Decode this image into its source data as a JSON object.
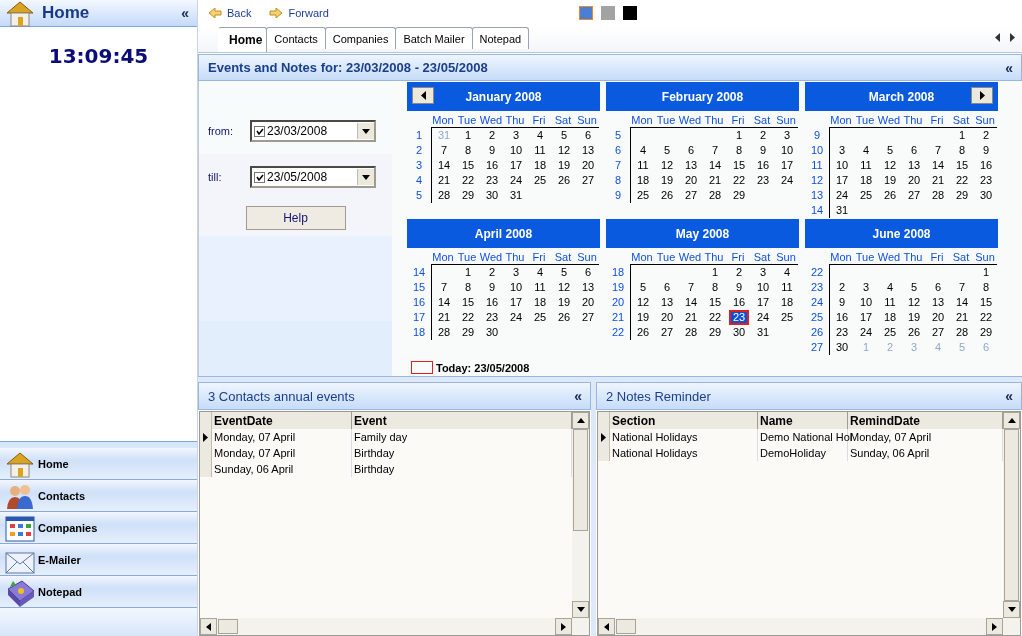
{
  "sidebar": {
    "title": "Home",
    "collapse": "«",
    "clock": "13:09:45",
    "nav": [
      {
        "label": "Home",
        "kind": "home"
      },
      {
        "label": "Contacts",
        "kind": "contacts"
      },
      {
        "label": "Companies",
        "kind": "companies"
      },
      {
        "label": "E-Mailer",
        "kind": "mailer"
      },
      {
        "label": "Notepad",
        "kind": "notepad"
      }
    ]
  },
  "toolbar": {
    "back": "Back",
    "forward": "Forward",
    "swatches": [
      {
        "color": "#4a7fd6",
        "selected": true
      },
      {
        "color": "#a3a3a3",
        "selected": false
      },
      {
        "color": "#000000",
        "selected": false
      }
    ]
  },
  "tabs": [
    {
      "label": "Home",
      "selected": true
    },
    {
      "label": "Contacts",
      "selected": false
    },
    {
      "label": "Companies",
      "selected": false
    },
    {
      "label": "Batch Mailer",
      "selected": false
    },
    {
      "label": "Notepad",
      "selected": false
    }
  ],
  "events_panel": {
    "title": "Events and Notes for: 23/03/2008 - 23/05/2008",
    "collapse": "«",
    "from": {
      "label": "from:",
      "checked": true,
      "value": "23/03/2008"
    },
    "till": {
      "label": "till:",
      "checked": true,
      "value": "23/05/2008"
    },
    "help_button": "Help",
    "months": [
      {
        "title": "January 2008",
        "prev_button": true,
        "weekdays": [
          "Mon",
          "Tue",
          "Wed",
          "Thu",
          "Fri",
          "Sat",
          "Sun"
        ],
        "weeks": [
          {
            "number": "1",
            "days": [
              {
                "day": "31",
                "dimmed": true
              },
              "1",
              "2",
              "3",
              "4",
              "5",
              "6"
            ]
          },
          {
            "number": "2",
            "days": [
              "7",
              "8",
              "9",
              "10",
              "11",
              "12",
              "13"
            ]
          },
          {
            "number": "3",
            "days": [
              "14",
              "15",
              "16",
              "17",
              "18",
              "19",
              "20"
            ]
          },
          {
            "number": "4",
            "days": [
              "21",
              "22",
              "23",
              "24",
              "25",
              "26",
              "27"
            ]
          },
          {
            "number": "5",
            "days": [
              "28",
              "29",
              "30",
              "31"
            ]
          }
        ]
      },
      {
        "title": "February 2008",
        "weekdays": [
          "Mon",
          "Tue",
          "Wed",
          "Thu",
          "Fri",
          "Sat",
          "Sun"
        ],
        "weeks": [
          {
            "number": "5",
            "right_aligned": true,
            "days": [
              "1",
              "2",
              "3"
            ]
          },
          {
            "number": "6",
            "days": [
              "4",
              "5",
              "6",
              "7",
              "8",
              "9",
              "10"
            ]
          },
          {
            "number": "7",
            "days": [
              "11",
              "12",
              "13",
              "14",
              "15",
              "16",
              "17"
            ]
          },
          {
            "number": "8",
            "days": [
              "18",
              "19",
              "20",
              "21",
              "22",
              "23",
              "24"
            ]
          },
          {
            "number": "9",
            "days": [
              "25",
              "26",
              "27",
              "28",
              "29"
            ]
          }
        ]
      },
      {
        "title": "March 2008",
        "next_button": true,
        "weekdays": [
          "Mon",
          "Tue",
          "Wed",
          "Thu",
          "Fri",
          "Sat",
          "Sun"
        ],
        "weeks": [
          {
            "number": "9",
            "right_aligned": true,
            "days": [
              "1",
              "2"
            ]
          },
          {
            "number": "10",
            "days": [
              "3",
              "4",
              "5",
              "6",
              "7",
              "8",
              "9"
            ]
          },
          {
            "number": "11",
            "days": [
              "10",
              "11",
              "12",
              "13",
              "14",
              "15",
              "16"
            ]
          },
          {
            "number": "12",
            "days": [
              "17",
              "18",
              "19",
              "20",
              "21",
              "22",
              "23"
            ]
          },
          {
            "number": "13",
            "days": [
              "24",
              "25",
              "26",
              "27",
              "28",
              "29",
              "30"
            ]
          },
          {
            "number": "14",
            "days": [
              "31"
            ]
          }
        ]
      },
      {
        "title": "April 2008",
        "weekdays": [
          "Mon",
          "Tue",
          "Wed",
          "Thu",
          "Fri",
          "Sat",
          "Sun"
        ],
        "weeks": [
          {
            "number": "14",
            "right_aligned": true,
            "days": [
              "1",
              "2",
              "3",
              "4",
              "5",
              "6"
            ]
          },
          {
            "number": "15",
            "days": [
              "7",
              "8",
              "9",
              "10",
              "11",
              "12",
              "13"
            ]
          },
          {
            "number": "16",
            "days": [
              "14",
              "15",
              "16",
              "17",
              "18",
              "19",
              "20"
            ]
          },
          {
            "number": "17",
            "days": [
              "21",
              "22",
              "23",
              "24",
              "25",
              "26",
              "27"
            ]
          },
          {
            "number": "18",
            "days": [
              "28",
              "29",
              "30"
            ]
          }
        ]
      },
      {
        "title": "May 2008",
        "weekdays": [
          "Mon",
          "Tue",
          "Wed",
          "Thu",
          "Fri",
          "Sat",
          "Sun"
        ],
        "weeks": [
          {
            "number": "18",
            "right_aligned": true,
            "days": [
              "1",
              "2",
              "3",
              "4"
            ]
          },
          {
            "number": "19",
            "days": [
              "5",
              "6",
              "7",
              "8",
              "9",
              "10",
              "11"
            ]
          },
          {
            "number": "20",
            "days": [
              "12",
              "13",
              "14",
              "15",
              "16",
              "17",
              "18"
            ]
          },
          {
            "number": "21",
            "days": [
              "19",
              "20",
              "21",
              "22",
              {
                "day": "23",
                "selected": true
              },
              "24",
              "25"
            ]
          },
          {
            "number": "22",
            "days": [
              "26",
              "27",
              "28",
              "29",
              "30",
              "31"
            ]
          }
        ]
      },
      {
        "title": "June 2008",
        "weekdays": [
          "Mon",
          "Tue",
          "Wed",
          "Thu",
          "Fri",
          "Sat",
          "Sun"
        ],
        "weeks": [
          {
            "number": "22",
            "right_aligned": true,
            "days": [
              "1"
            ]
          },
          {
            "number": "23",
            "days": [
              "2",
              "3",
              "4",
              "5",
              "6",
              "7",
              "8"
            ]
          },
          {
            "number": "24",
            "days": [
              "9",
              "10",
              "11",
              "12",
              "13",
              "14",
              "15"
            ]
          },
          {
            "number": "25",
            "days": [
              "16",
              "17",
              "18",
              "19",
              "20",
              "21",
              "22"
            ]
          },
          {
            "number": "26",
            "days": [
              "23",
              "24",
              "25",
              "26",
              "27",
              "28",
              "29"
            ]
          },
          {
            "number": "27",
            "days": [
              "30",
              {
                "day": "1",
                "dimmed": true
              },
              {
                "day": "2",
                "dimmed": true
              },
              {
                "day": "3",
                "dimmed": true
              },
              {
                "day": "4",
                "dimmed": true
              },
              {
                "day": "5",
                "dimmed": true
              },
              {
                "day": "6",
                "dimmed": true
              }
            ]
          }
        ]
      }
    ],
    "today": "Today: 23/05/2008"
  },
  "contacts_panel": {
    "title": "3 Contacts annual events",
    "collapse": "«",
    "columns": [
      "EventDate",
      "Event"
    ],
    "rows": [
      {
        "cells": [
          "Monday, 07 April",
          "Family day"
        ],
        "selected": true
      },
      {
        "cells": [
          "Monday, 07 April",
          "Birthday"
        ],
        "selected": false
      },
      {
        "cells": [
          "Sunday, 06 April",
          "Birthday"
        ],
        "selected": false
      }
    ]
  },
  "notes_panel": {
    "title": "2 Notes Reminder",
    "collapse": "«",
    "columns": [
      "Section",
      "Name",
      "RemindDate"
    ],
    "rows": [
      {
        "cells": [
          "National Holidays",
          "Demo National Hol",
          "Monday, 07 April"
        ],
        "selected": true
      },
      {
        "cells": [
          "National Holidays",
          "DemoHoliday",
          "Sunday, 06 April"
        ],
        "selected": false
      }
    ]
  }
}
